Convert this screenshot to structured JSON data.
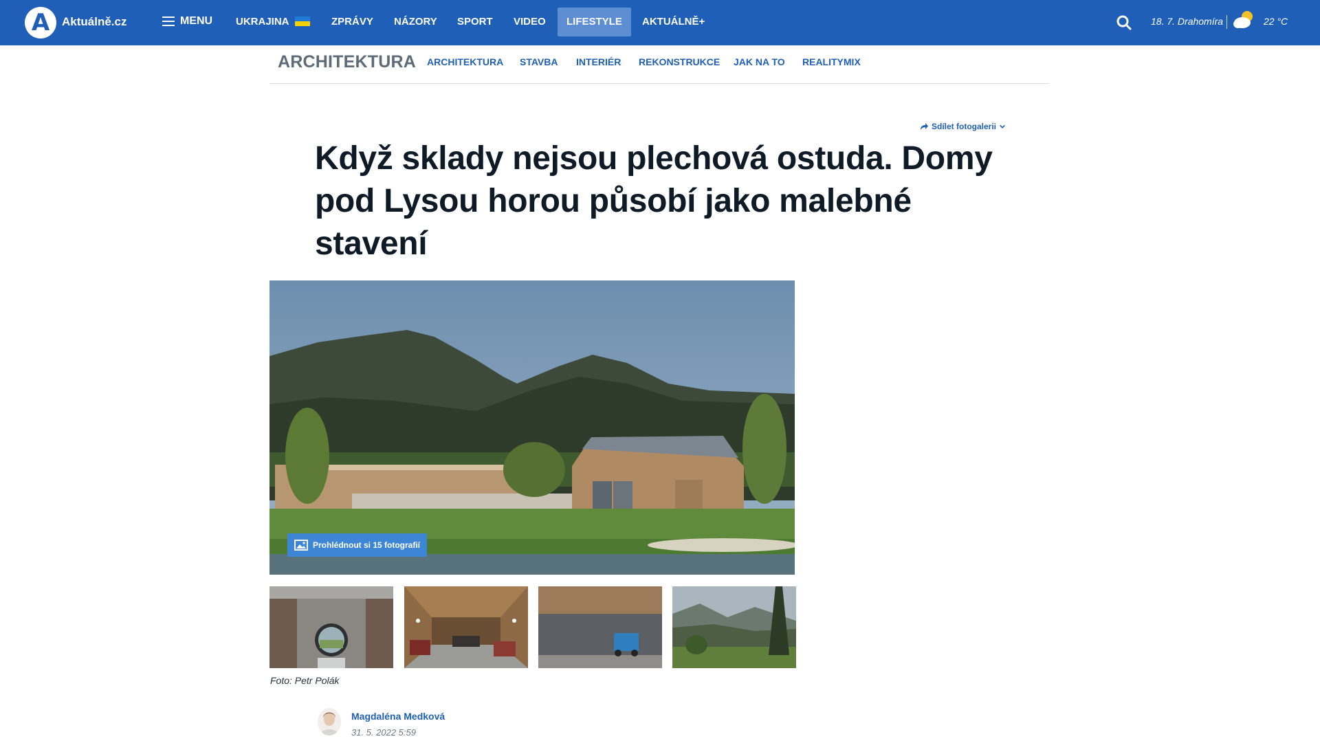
{
  "brand": {
    "logo_letter": "A",
    "name": "Aktuálně.cz",
    "color": "#1f5fb7"
  },
  "topnav": {
    "menu_label": "MENU",
    "items": [
      {
        "label": "UKRAJINA"
      },
      {
        "label": "ZPRÁVY"
      },
      {
        "label": "NÁZORY"
      },
      {
        "label": "SPORT"
      },
      {
        "label": "VIDEO"
      },
      {
        "label": "LIFESTYLE",
        "active": true
      },
      {
        "label": "AKTUÁLNĚ+"
      }
    ],
    "date_text": "18. 7. Drahomíra",
    "temperature": "22 °C",
    "weather_icon": "partly-cloudy-icon"
  },
  "section": {
    "title": "ARCHITEKTURA",
    "items": [
      {
        "label": "ARCHITEKTURA"
      },
      {
        "label": "STAVBA"
      },
      {
        "label": "INTERIÉR"
      },
      {
        "label": "REKONSTRUKCE"
      },
      {
        "label": "JAK NA TO"
      },
      {
        "label": "REALITYMIX"
      }
    ]
  },
  "article": {
    "share_label": "Sdílet fotogalerii",
    "headline": "Když sklady nejsou plechová ostuda. Domy pod Lysou horou působí jako malebné stavení",
    "gallery_button": "Prohlédnout si 15 fotografií",
    "photo_credit": "Foto: Petr Polák",
    "author": "Magdaléna Medková",
    "published": "31. 5. 2022 5:59"
  }
}
